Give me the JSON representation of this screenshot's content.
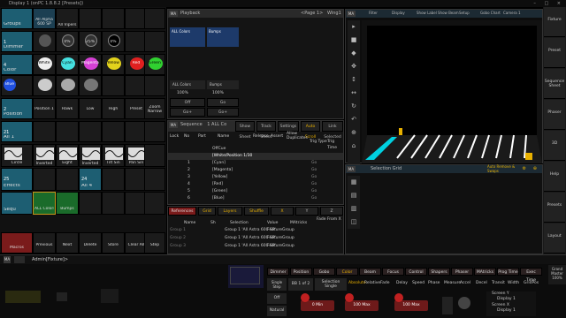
{
  "window": {
    "title": "Display 1 (onPC 1.8.8.2 [Presets])",
    "controls": "– □ ×"
  },
  "pool": {
    "groups_label": "Groups",
    "group_cells": [
      "All Alpha 600 SP",
      "All Vipers"
    ],
    "dimmer": {
      "num": "1",
      "label": "Dimmer"
    },
    "dimmer_cells": [
      "",
      "0%",
      "25%",
      "0%"
    ],
    "color": {
      "num": "4",
      "label": "Color"
    },
    "color_cells": [
      "White",
      "Cyan",
      "Magenta",
      "Yellow",
      "Red",
      "Green",
      "Blue",
      "",
      "",
      ""
    ],
    "position": {
      "num": "2",
      "label": "Position"
    },
    "position_cells": [
      "Position 1",
      "Hawk",
      "Low",
      "High",
      "Preset",
      "Zoom Narrow"
    ],
    "all1": {
      "num": "21",
      "label": "All 1"
    },
    "wave_cells": [
      "Circle",
      "Circle Inverted",
      "Eight",
      "Eight Inverted",
      "Tilt Sin",
      "Pan Sin"
    ],
    "effects": {
      "num": "25",
      "label": "Effects"
    },
    "all4": {
      "num": "24",
      "label": "All 4"
    },
    "sequ": {
      "label": "Sequ"
    },
    "seq_cells": [
      "ALL Colors",
      "Bumps"
    ],
    "macros": {
      "num": "13",
      "label": "Macros"
    },
    "macro_cells": [
      "Previous",
      "Next",
      "Delete",
      "Store",
      "Clear All",
      "Step"
    ]
  },
  "playback": {
    "title": "Playback",
    "page": "<Page 1>",
    "wing": "Wing1",
    "faders": [
      "ALL Colors",
      "Bumps"
    ],
    "pct": [
      "100%",
      "100%",
      "100%"
    ],
    "buttons": [
      "Off",
      "Go",
      "Go+"
    ]
  },
  "viewer": {
    "labels": [
      "Filter",
      "Display",
      "Show Label",
      "Show Beam",
      "Setup",
      "Gobo Chart",
      "Camera 1"
    ]
  },
  "sequence": {
    "title": "Sequence",
    "subtitle": "1 ALL Co",
    "tabs": [
      "Show Sheet",
      "Track Sheet",
      "Settings",
      "Auto Scroll",
      "Link Selected"
    ],
    "headers": [
      "Lock",
      "No",
      "Part",
      "Name",
      "Release",
      "Assert",
      "Allow Duplicates",
      "Trig Type",
      "Trig Time"
    ],
    "rows": [
      {
        "no": "",
        "name": "OffCue"
      },
      {
        "no": "",
        "name": "[White/Position 1/30"
      },
      {
        "no": "1",
        "name": "[Cyan]"
      },
      {
        "no": "2",
        "name": "[Magenta]"
      },
      {
        "no": "3",
        "name": "[Yellow]"
      },
      {
        "no": "4",
        "name": "[Red]"
      },
      {
        "no": "5",
        "name": "[Green]"
      },
      {
        "no": "6",
        "name": "[Blue]"
      }
    ],
    "go_labels": [
      "Go",
      "Go",
      "Go",
      "Go",
      "Go",
      "Go"
    ]
  },
  "references": {
    "tabs": [
      "References",
      "Grid",
      "Layers",
      "Shuffle",
      "X",
      "Y",
      "Z"
    ],
    "headers": [
      "Name",
      "Sh",
      "Selection",
      "Value",
      "MAtricks",
      "Fade From X"
    ],
    "rows": [
      {
        "name": "Group 1",
        "selection": "Group 1 'All Astra 600 SP'",
        "value": "FeatureGroup"
      },
      {
        "name": "Group 2",
        "selection": "Group 1 'All Astra 600 SP'",
        "value": "FeatureGroup"
      },
      {
        "name": "Group 3",
        "selection": "Group 1 'All Astra 600 SP'",
        "value": "FeatureGroup"
      }
    ]
  },
  "selection_grid": {
    "title": "Selection Grid",
    "auto": "Auto Remove & Swaps"
  },
  "right_bar": [
    "Fixture",
    "Preset",
    "Sequence Sheet",
    "Phaser",
    "3D",
    "Help",
    "Presets",
    "Layout"
  ],
  "command": {
    "prompt": "Admin[Fixture]>"
  },
  "encoder_bar": {
    "tabs": [
      "Dimmer",
      "Position",
      "Gobo",
      "Color",
      "Beam",
      "Focus",
      "Control",
      "Shapers",
      "Phaser",
      "MAtricks",
      "Prog Time",
      "Exec Time"
    ],
    "grand": "Grand Master 100%",
    "row2": [
      "Single Step",
      "BB 1 of 2",
      "Selection",
      "Single"
    ],
    "row3": [
      "Absolute",
      "Relative",
      "Fade",
      "Delay",
      "Speed",
      "Phase",
      "Measure",
      "Accel",
      "Decel",
      "Transit",
      "Width",
      "GridPos"
    ],
    "enc": [
      "0  Min",
      "100  Max",
      "100  Max"
    ],
    "natural": "Natural",
    "off": "Off",
    "screens": [
      "Screen Y",
      "Display 1",
      "Screen X",
      "Display 1"
    ]
  },
  "colors": {
    "accent": "#1d5e72",
    "macro": "#7a1b1b",
    "sequ": "#1a6b2a",
    "warn": "#c8961a",
    "cyan": "#00d0e0"
  }
}
